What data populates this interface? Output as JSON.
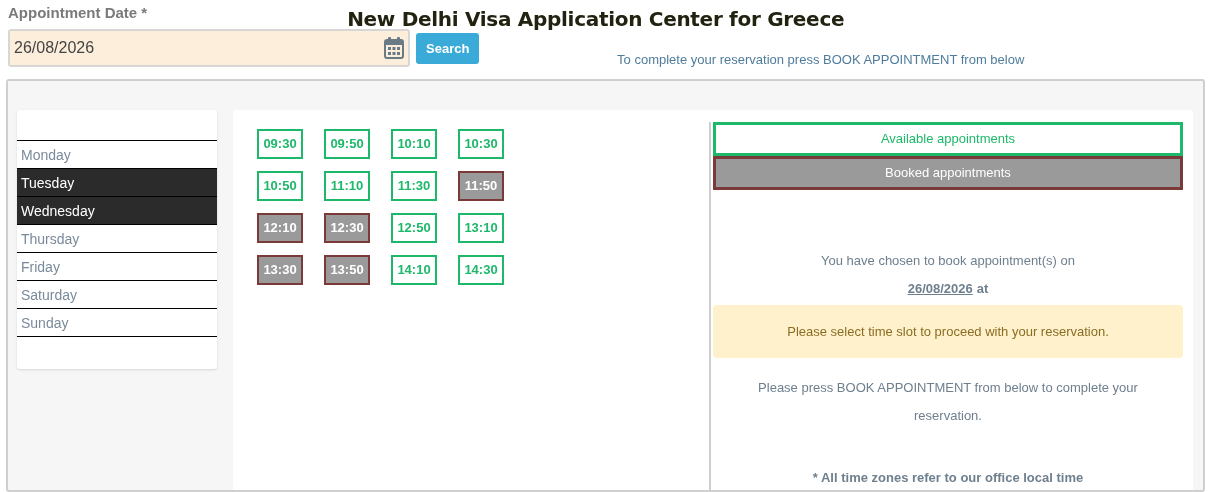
{
  "date_field": {
    "label": "Appointment Date *",
    "value": "26/08/2026"
  },
  "search_button": "Search",
  "title": "New Delhi Visa Application Center for Greece",
  "instruction": "To complete your reservation press BOOK APPOINTMENT from below",
  "days": [
    {
      "label": "Monday",
      "selected": false
    },
    {
      "label": "Tuesday",
      "selected": true
    },
    {
      "label": "Wednesday",
      "selected": true
    },
    {
      "label": "Thursday",
      "selected": false
    },
    {
      "label": "Friday",
      "selected": false
    },
    {
      "label": "Saturday",
      "selected": false
    },
    {
      "label": "Sunday",
      "selected": false
    }
  ],
  "slots": [
    {
      "time": "09:30",
      "booked": false
    },
    {
      "time": "09:50",
      "booked": false
    },
    {
      "time": "10:10",
      "booked": false
    },
    {
      "time": "10:30",
      "booked": false
    },
    {
      "time": "10:50",
      "booked": false
    },
    {
      "time": "11:10",
      "booked": false
    },
    {
      "time": "11:30",
      "booked": false
    },
    {
      "time": "11:50",
      "booked": true
    },
    {
      "time": "12:10",
      "booked": true
    },
    {
      "time": "12:30",
      "booked": true
    },
    {
      "time": "12:50",
      "booked": false
    },
    {
      "time": "13:10",
      "booked": false
    },
    {
      "time": "13:30",
      "booked": true
    },
    {
      "time": "13:50",
      "booked": true
    },
    {
      "time": "14:10",
      "booked": false
    },
    {
      "time": "14:30",
      "booked": false
    }
  ],
  "legend": [
    {
      "label": "Available appointments",
      "booked": false
    },
    {
      "label": "Booked appointments",
      "booked": true
    }
  ],
  "summary": {
    "chosen_text": "You have chosen to book appointment(s) on",
    "date": "26/08/2026",
    "date_suffix": "at",
    "alert": "Please select time slot to proceed with your reservation.",
    "press_text": "Please press BOOK APPOINTMENT from below to complete your reservation.",
    "footnote": "* All time zones refer to our office local time"
  }
}
